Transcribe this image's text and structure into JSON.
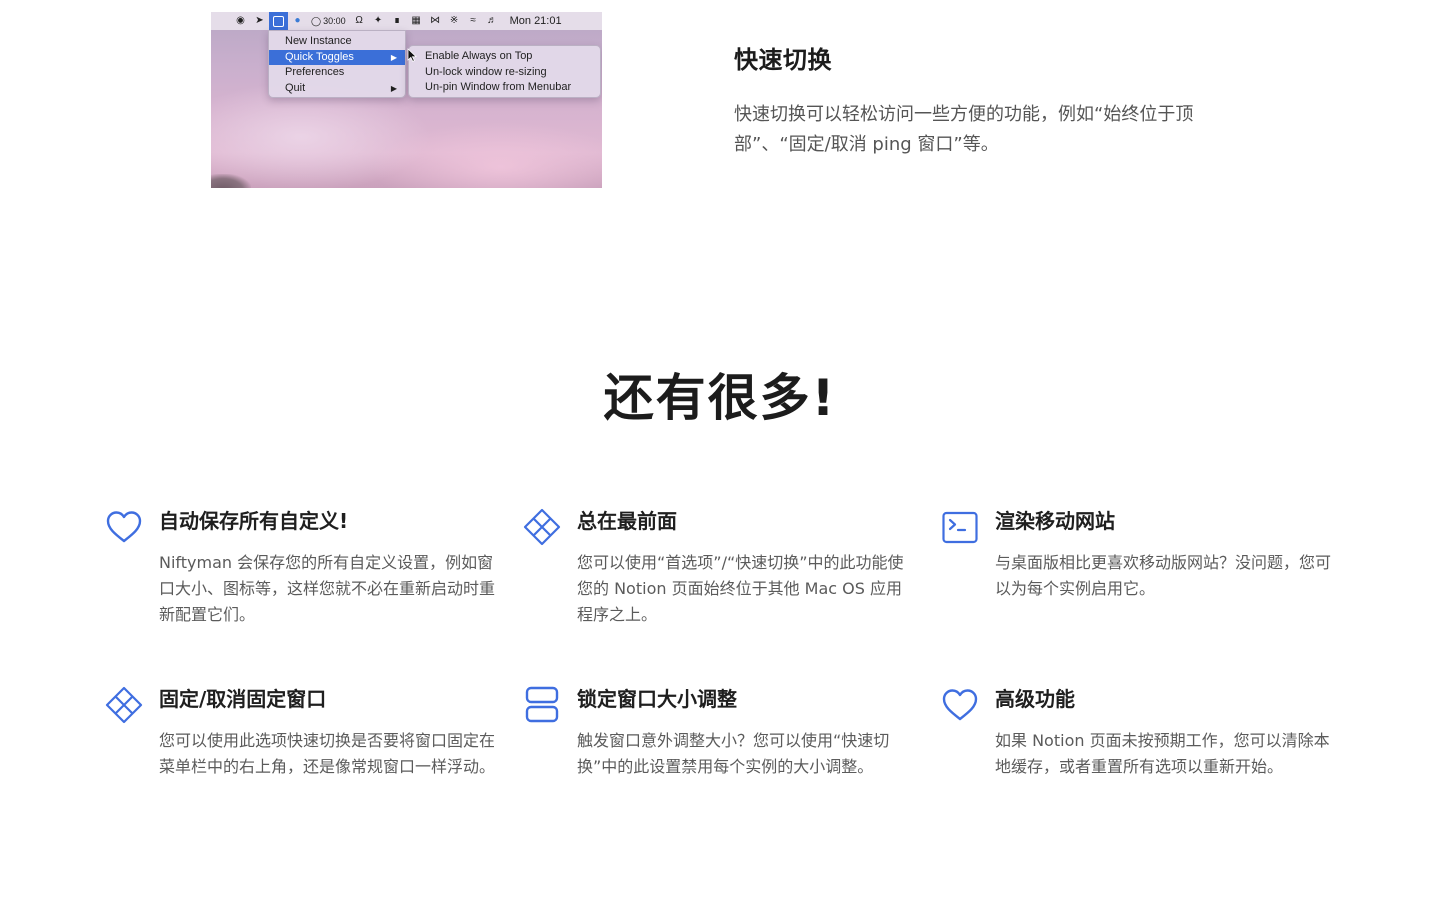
{
  "screenshot": {
    "menubar_timer": "30:00",
    "menubar_clock": "Mon 21:01",
    "menu_items": [
      {
        "label": "New Instance",
        "has_submenu": false,
        "highlighted": false
      },
      {
        "label": "Quick Toggles",
        "has_submenu": true,
        "highlighted": true
      },
      {
        "label": "Preferences",
        "has_submenu": false,
        "highlighted": false
      },
      {
        "label": "Quit",
        "has_submenu": true,
        "highlighted": false
      }
    ],
    "submenu_items": [
      {
        "label": "Enable Always on Top"
      },
      {
        "label": "Un-lock window re-sizing"
      },
      {
        "label": "Un-pin Window from Menubar"
      }
    ],
    "menubar_icons": [
      "globe-icon",
      "rocket-icon",
      "app-icon",
      "whale-icon",
      "timer-icon",
      "headphones-icon",
      "magic-wand-icon",
      "airpods-icon",
      "calendar-icon",
      "bowtie-icon",
      "bluetooth-icon",
      "wifi-icon",
      "volume-icon"
    ]
  },
  "quick_toggle": {
    "title": "快速切换",
    "description": "快速切换可以轻松访问一些方便的功能，例如“始终位于顶部”、“固定/取消 ping 窗口”等。"
  },
  "more": {
    "title": "还有很多!"
  },
  "features": [
    {
      "icon": "heart-icon",
      "title": "自动保存所有自定义!",
      "description": "Niftyman 会保存您的所有自定义设置，例如窗口大小、图标等，这样您就不必在重新启动时重新配置它们。"
    },
    {
      "icon": "diamond-grid-icon",
      "title": "总在最前面",
      "description": "您可以使用“首选项”/“快速切换”中的此功能使您的 Notion 页面始终位于其他 Mac OS 应用程序之上。"
    },
    {
      "icon": "terminal-icon",
      "title": "渲染移动网站",
      "description": "与桌面版相比更喜欢移动版网站？没问题，您可以为每个实例启用它。"
    },
    {
      "icon": "diamond-grid-icon",
      "title": "固定/取消固定窗口",
      "description": "您可以使用此选项快速切换是否要将窗口固定在菜单栏中的右上角，还是像常规窗口一样浮动。"
    },
    {
      "icon": "stacked-rows-icon",
      "title": "锁定窗口大小调整",
      "description": "触发窗口意外调整大小？您可以使用“快速切换”中的此设置禁用每个实例的大小调整。"
    },
    {
      "icon": "heart-icon",
      "title": "高级功能",
      "description": "如果 Notion 页面未按预期工作，您可以清除本地缓存，或者重置所有选项以重新开始。"
    }
  ],
  "colors": {
    "accent": "#3b6fd8",
    "icon_blue": "#3f6ee0",
    "heading": "#1c1c1c",
    "body_text": "#5b5b5b"
  }
}
